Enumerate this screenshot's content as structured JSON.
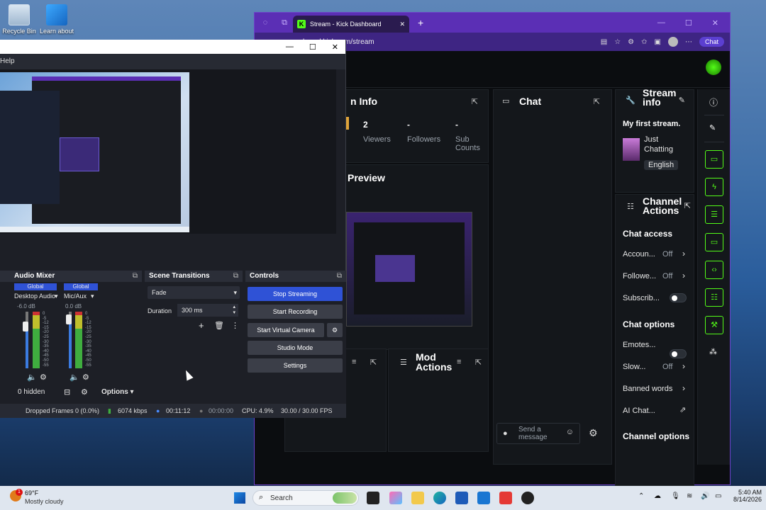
{
  "desktop": {
    "icons": [
      {
        "label": "Recycle Bin",
        "icon": "recycle-bin-icon"
      },
      {
        "label": "Learn about",
        "icon": "learn-about-icon"
      }
    ]
  },
  "browser": {
    "tab_title": "Stream - Kick Dashboard",
    "url": "board.kick.com/stream",
    "chat_button": "Chat"
  },
  "kick": {
    "stream_info_title": "n Info",
    "stats": [
      {
        "value": "2",
        "label": "Viewers"
      },
      {
        "value": "-",
        "label": "Followers"
      },
      {
        "value": "-",
        "label": "Sub Counts"
      }
    ],
    "preview_title": "Preview",
    "chat_title": "Chat",
    "chat_placeholder": "Send a message",
    "mod_actions_title": "Mod Actions",
    "stream_info_panel": {
      "title_line1": "Stream",
      "title_line2": "info",
      "stream_title": "My first stream.",
      "category_line1": "Just",
      "category_line2": "Chatting",
      "language": "English"
    },
    "channel_actions": {
      "title_line1": "Channel",
      "title_line2": "Actions",
      "chat_access": "Chat access",
      "account_label": "Accoun...",
      "account_value": "Off",
      "followers_label": "Followe...",
      "followers_value": "Off",
      "subscribers_label": "Subscrib...",
      "chat_options": "Chat options",
      "emotes_label": "Emotes...",
      "slow_label": "Slow...",
      "slow_value": "Off",
      "banned_words": "Banned words",
      "ai_chat": "AI Chat...",
      "channel_options": "Channel options"
    }
  },
  "obs": {
    "menu_help": "Help",
    "audio_mixer": {
      "title": "Audio Mixer",
      "channels": [
        {
          "badge": "Global",
          "name": "Desktop Audio",
          "db": "-6.0 dB"
        },
        {
          "badge": "Global",
          "name": "Mic/Aux",
          "db": "0.0 dB"
        }
      ],
      "scale": [
        "0",
        "-5",
        "-12",
        "-15",
        "-20",
        "-25",
        "-30",
        "-35",
        "-40",
        "-45",
        "-50",
        "-55",
        "-60"
      ],
      "hidden": "0 hidden",
      "options": "Options"
    },
    "scene_transitions": {
      "title": "Scene Transitions",
      "transition": "Fade",
      "duration_label": "Duration",
      "duration_value": "300 ms"
    },
    "controls": {
      "title": "Controls",
      "stop_streaming": "Stop Streaming",
      "start_recording": "Start Recording",
      "start_virtual_camera": "Start Virtual Camera",
      "studio_mode": "Studio Mode",
      "settings": "Settings"
    },
    "status": {
      "dropped_frames": "Dropped Frames 0 (0.0%)",
      "bitrate": "6074 kbps",
      "stream_time": "00:11:12",
      "rec_time": "00:00:00",
      "cpu": "CPU: 4.9%",
      "fps": "30.00 / 30.00 FPS"
    }
  },
  "taskbar": {
    "weather_temp": "69°F",
    "weather_desc": "Mostly cloudy",
    "search_placeholder": "Search",
    "time": "5:40 AM",
    "date": "8/14/2026",
    "notification_count": "1"
  },
  "colors": {
    "kick_green": "#53fc18",
    "browser_purple": "#5b2fb5",
    "obs_blue": "#2f52d6"
  }
}
